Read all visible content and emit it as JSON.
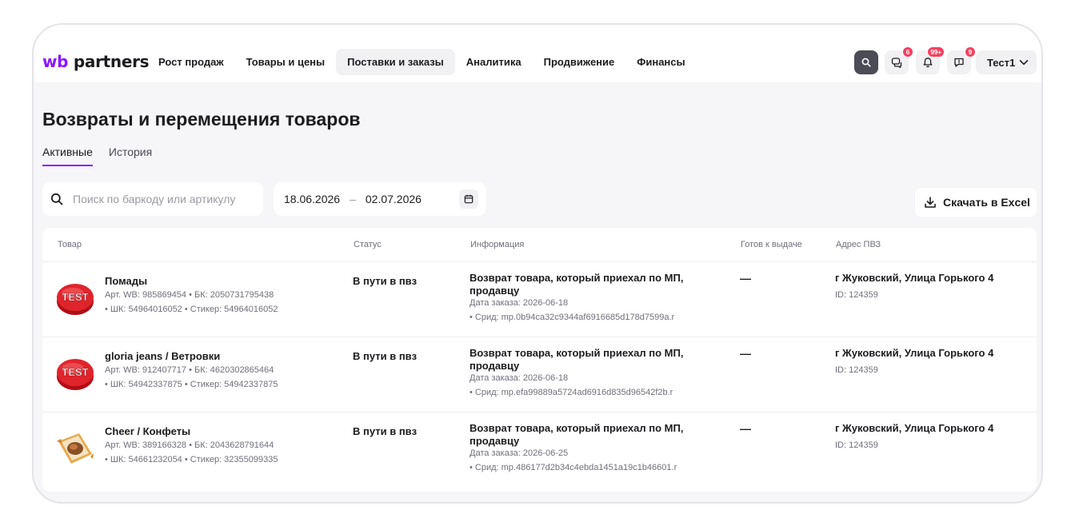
{
  "brand": {
    "logo_prefix": "wb",
    "logo_suffix": "partners",
    "accent": "#8a16ff",
    "badge_color": "#f5405f"
  },
  "nav": [
    {
      "label": "Рост продаж",
      "active": false
    },
    {
      "label": "Товары и цены",
      "active": false
    },
    {
      "label": "Поставки и заказы",
      "active": true
    },
    {
      "label": "Аналитика",
      "active": false
    },
    {
      "label": "Продвижение",
      "active": false
    },
    {
      "label": "Финансы",
      "active": false
    }
  ],
  "header_actions": {
    "search_icon": "search-icon",
    "chat_badge": "6",
    "notifications_badge": "99+",
    "messages_badge": "9",
    "user_name": "Тест1"
  },
  "page": {
    "title": "Возвраты и перемещения товаров",
    "tabs": [
      {
        "label": "Активные",
        "active": true
      },
      {
        "label": "История",
        "active": false
      }
    ]
  },
  "filters": {
    "search_placeholder": "Поиск по баркоду или артикулу",
    "date_from": "18.06.2026",
    "date_sep": "–",
    "date_to": "02.07.2026",
    "download_label": "Скачать в Excel"
  },
  "table": {
    "columns": [
      "Товар",
      "Статус",
      "Информация",
      "Готов к выдаче",
      "Адрес ПВЗ"
    ],
    "rows": [
      {
        "thumb": "test-button-image",
        "name": "Помады",
        "art_line": "Арт. WB: 985869454 • БК: 2050731795438",
        "sh_line": "• ШК: 54964016052 • Стикер: 54964016052",
        "status": "В пути в пвз",
        "info_title": "Возврат товара, который приехал по МП, продавцу",
        "order_date": "Дата заказа: 2026-06-18",
        "srid": "• Срид: mp.0b94ca32c9344af6916685d178d7599a.r",
        "ready": "—",
        "address": "г Жуковский, Улица Горького 4",
        "pvz_id": "ID: 124359"
      },
      {
        "thumb": "test-button-image",
        "name": "gloria jeans / Ветровки",
        "art_line": "Арт. WB: 912407717 • БК: 4620302865464",
        "sh_line": "• ШК: 54942337875 • Стикер: 54942337875",
        "status": "В пути в пвз",
        "info_title": "Возврат товара, который приехал по МП, продавцу",
        "order_date": "Дата заказа: 2026-06-18",
        "srid": "• Срид: mp.efa99889a5724ad6916d835d96542f2b.r",
        "ready": "—",
        "address": "г Жуковский, Улица Горького 4",
        "pvz_id": "ID: 124359"
      },
      {
        "thumb": "candy-image",
        "name": "Cheer / Конфеты",
        "art_line": "Арт. WB: 389166328 • БК: 2043628791644",
        "sh_line": "• ШК: 54661232054 • Стикер: 32355099335",
        "status": "В пути в пвз",
        "info_title": "Возврат товара, который приехал по МП, продавцу",
        "order_date": "Дата заказа: 2026-06-25",
        "srid": "• Срид: mp.486177d2b34c4ebda1451a19c1b46601.r",
        "ready": "—",
        "address": "г Жуковский, Улица Горького 4",
        "pvz_id": "ID: 124359"
      }
    ]
  }
}
